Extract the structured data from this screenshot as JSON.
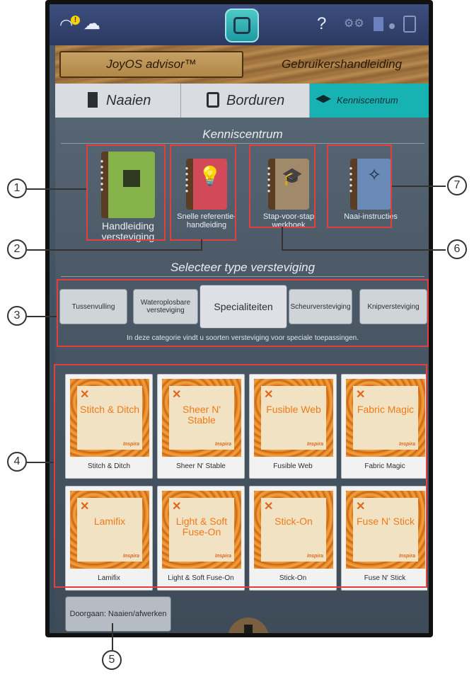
{
  "statusbar": {
    "wifi_icon": "wifi-alert-icon",
    "wifi_badge": "!",
    "cloud_icon": "cloud-icon",
    "help_label": "?",
    "settings_icon": "gears-icon"
  },
  "header": {
    "advisor_label": "JoyOS advisor™",
    "manual_label": "Gebruikershandleiding"
  },
  "tabs": [
    {
      "label": "Naaien"
    },
    {
      "label": "Borduren"
    },
    {
      "label": "Kenniscentrum"
    }
  ],
  "kenniscentrum": {
    "title": "Kenniscentrum",
    "books": [
      {
        "label": "Handleiding versteviging",
        "icon": "stabilizer-book-icon",
        "color": "#86b24a"
      },
      {
        "label": "Snelle referentie-handleiding",
        "icon": "lightbulb-book-icon",
        "color": "#d24a5a"
      },
      {
        "label": "Stap-voor-stap werkboek",
        "icon": "graduation-cap-book-icon",
        "color": "#a18a6a"
      },
      {
        "label": "Naai-instructies",
        "icon": "magic-wand-book-icon",
        "color": "#6a8ab8"
      }
    ]
  },
  "type_selector": {
    "title": "Selecteer type versteviging",
    "buttons": [
      {
        "label": "Tussenvulling"
      },
      {
        "label": "Wateroplosbare versteviging"
      },
      {
        "label": "Specialiteiten"
      },
      {
        "label": "Scheurversteviging"
      },
      {
        "label": "Knipversteviging"
      }
    ],
    "selected": "Specialiteiten",
    "description": "In deze categorie vindt u soorten versteviging voor speciale toepassingen."
  },
  "products": [
    {
      "title": "Stitch & Ditch",
      "caption": "Stitch & Ditch"
    },
    {
      "title": "Sheer N' Stable",
      "caption": "Sheer N' Stable"
    },
    {
      "title": "Fusible Web",
      "caption": "Fusible Web"
    },
    {
      "title": "Fabric Magic",
      "caption": "Fabric Magic"
    },
    {
      "title": "Lamifix",
      "caption": "Lamifix"
    },
    {
      "title": "Light & Soft Fuse-On",
      "caption": "Light & Soft Fuse-On"
    },
    {
      "title": "Stick-On",
      "caption": "Stick-On"
    },
    {
      "title": "Fuse N' Stick",
      "caption": "Fuse N' Stick"
    }
  ],
  "product_brand": "Inspira",
  "continue_button": {
    "label": "Doorgaan: Naaien/afwerken"
  },
  "callouts": [
    "1",
    "2",
    "3",
    "4",
    "5",
    "6",
    "7"
  ],
  "accent_color": "#17b3b3",
  "highlight_color": "#e53e3e"
}
